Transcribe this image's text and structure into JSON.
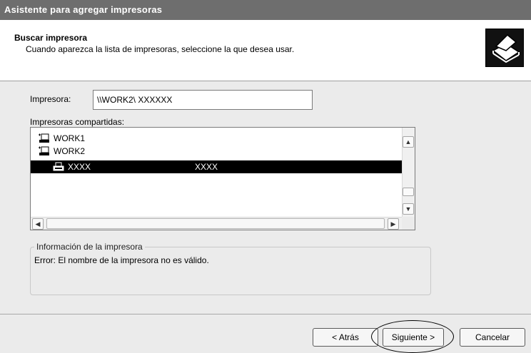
{
  "window": {
    "title": "Asistente para agregar impresoras"
  },
  "header": {
    "title": "Buscar impresora",
    "subtitle": "Cuando aparezca la lista de impresoras, seleccione la que desea usar."
  },
  "printer_field": {
    "label": "Impresora:",
    "value": "\\\\WORK2\\ XXXXXX"
  },
  "shared_label": "Impresoras compartidas:",
  "shared_list": [
    {
      "name": "WORK1",
      "icon": "network-computer-icon"
    },
    {
      "name": "WORK2",
      "icon": "network-computer-icon"
    },
    {
      "name": "XXXX",
      "comment": "XXXX",
      "icon": "printer-icon",
      "selected": true
    }
  ],
  "printer_info": {
    "title": "Información de la impresora",
    "error": "Error: El nombre de la impresora no es válido."
  },
  "buttons": {
    "back": "< Atrás",
    "next": "Siguiente >",
    "cancel": "Cancelar"
  }
}
